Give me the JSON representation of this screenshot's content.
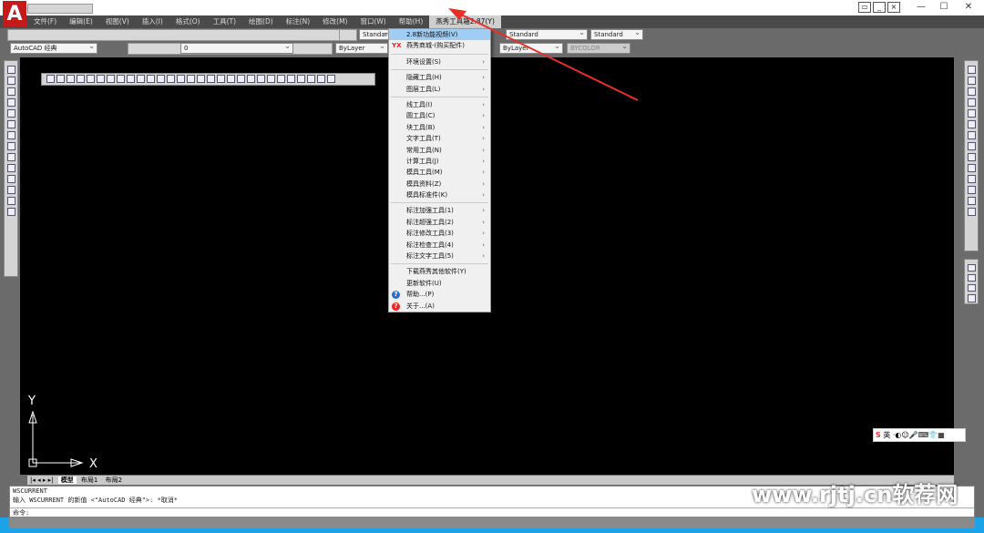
{
  "app": {
    "logo": "A"
  },
  "window_controls": {
    "minimize": "—",
    "maximize": "☐",
    "close": "✕"
  },
  "menubar": [
    "文件(F)",
    "编辑(E)",
    "视图(V)",
    "插入(I)",
    "格式(O)",
    "工具(T)",
    "绘图(D)",
    "标注(N)",
    "修改(M)",
    "窗口(W)",
    "帮助(H)",
    "燕秀工具箱2.87(Y)"
  ],
  "toolbar": {
    "text_style": "Standard",
    "dim_style": "Standard",
    "workspace": "AutoCAD 经典",
    "layer": "0",
    "color": "ByLayer",
    "linetype": "ByLayer",
    "plotstyle": "BYCOLOR"
  },
  "dropdown": {
    "items": [
      {
        "label": "2.8新功能视频(V)",
        "highlight": true
      },
      {
        "label": "燕秀商城-(购买配件)",
        "icon": "YX"
      },
      {
        "sep": true
      },
      {
        "label": "环境设置(S)",
        "sub": true
      },
      {
        "sep": true
      },
      {
        "label": "隐藏工具(H)",
        "sub": true
      },
      {
        "label": "图层工具(L)",
        "sub": true
      },
      {
        "sep": true
      },
      {
        "label": "线工具(I)",
        "sub": true
      },
      {
        "label": "圆工具(C)",
        "sub": true
      },
      {
        "label": "块工具(B)",
        "sub": true
      },
      {
        "label": "文字工具(T)",
        "sub": true
      },
      {
        "label": "常用工具(N)",
        "sub": true
      },
      {
        "label": "计算工具(J)",
        "sub": true
      },
      {
        "label": "模具工具(M)",
        "sub": true
      },
      {
        "label": "模具资料(Z)",
        "sub": true
      },
      {
        "label": "模具标准件(K)",
        "sub": true
      },
      {
        "sep": true
      },
      {
        "label": "标注加强工具(1)",
        "sub": true
      },
      {
        "label": "标注超强工具(2)",
        "sub": true
      },
      {
        "label": "标注修改工具(3)",
        "sub": true
      },
      {
        "label": "标注检查工具(4)",
        "sub": true
      },
      {
        "label": "标注文字工具(5)",
        "sub": true
      },
      {
        "sep": true
      },
      {
        "label": "下载燕秀其他软件(Y)"
      },
      {
        "label": "更新软件(U)"
      },
      {
        "label": "帮助...(P)",
        "icon": "help-icon"
      },
      {
        "label": "关于...(A)",
        "icon": "about-icon"
      }
    ]
  },
  "ucs": {
    "x": "X",
    "y": "Y"
  },
  "tabs": [
    "模型",
    "布局1",
    "布局2"
  ],
  "command": {
    "line1": "WSCURRENT",
    "line2": "输入 WSCURRENT 的新值 <\"AutoCAD 经典\">: *取消*",
    "prompt": "命令:"
  },
  "ime": {
    "label": "英"
  },
  "watermark": "www.rjtj.cn软荐网",
  "colors": {
    "accent": "#1aa3e8",
    "arrow": "#e8302a",
    "highlight": "#9fcdf3"
  }
}
